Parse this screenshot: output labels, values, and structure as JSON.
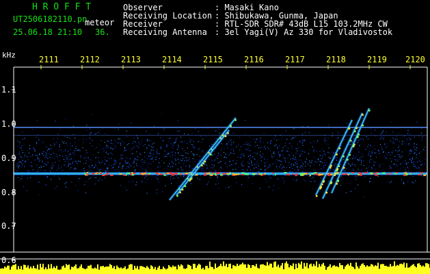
{
  "header": {
    "brand": "H R O F F T",
    "filename": "UT2506182110.pn",
    "mode": "meteor",
    "datetime": "25.06.18 21:10",
    "seconds": "36."
  },
  "info": [
    {
      "label": "Observer",
      "value": ": Masaki Kano"
    },
    {
      "label": "Receiving Location",
      "value": ": Shibukawa, Gunma, Japan"
    },
    {
      "label": "Receiver",
      "value": ": RTL-SDR SDR# 43dB L15 103.2MHz CW"
    },
    {
      "label": "Receiving Antenna",
      "value": ": 3el Yagi(V) Az 330 for Vladivostok"
    }
  ],
  "axes": {
    "y_unit": "kHz",
    "y_ticks": [
      "1.1",
      "1.0",
      "0.9",
      "0.8",
      "0.7",
      "0.6"
    ],
    "x_ticks": [
      "2111",
      "2112",
      "2113",
      "2114",
      "2115",
      "2116",
      "2117",
      "2118",
      "2119",
      "2120"
    ]
  },
  "colors": {
    "text_green": "#16e016",
    "text_white": "#ffffff",
    "tick_yellow": "#ffff33",
    "signal_red": "#ff3030",
    "spectrum_yellow": "#ffff20"
  }
}
